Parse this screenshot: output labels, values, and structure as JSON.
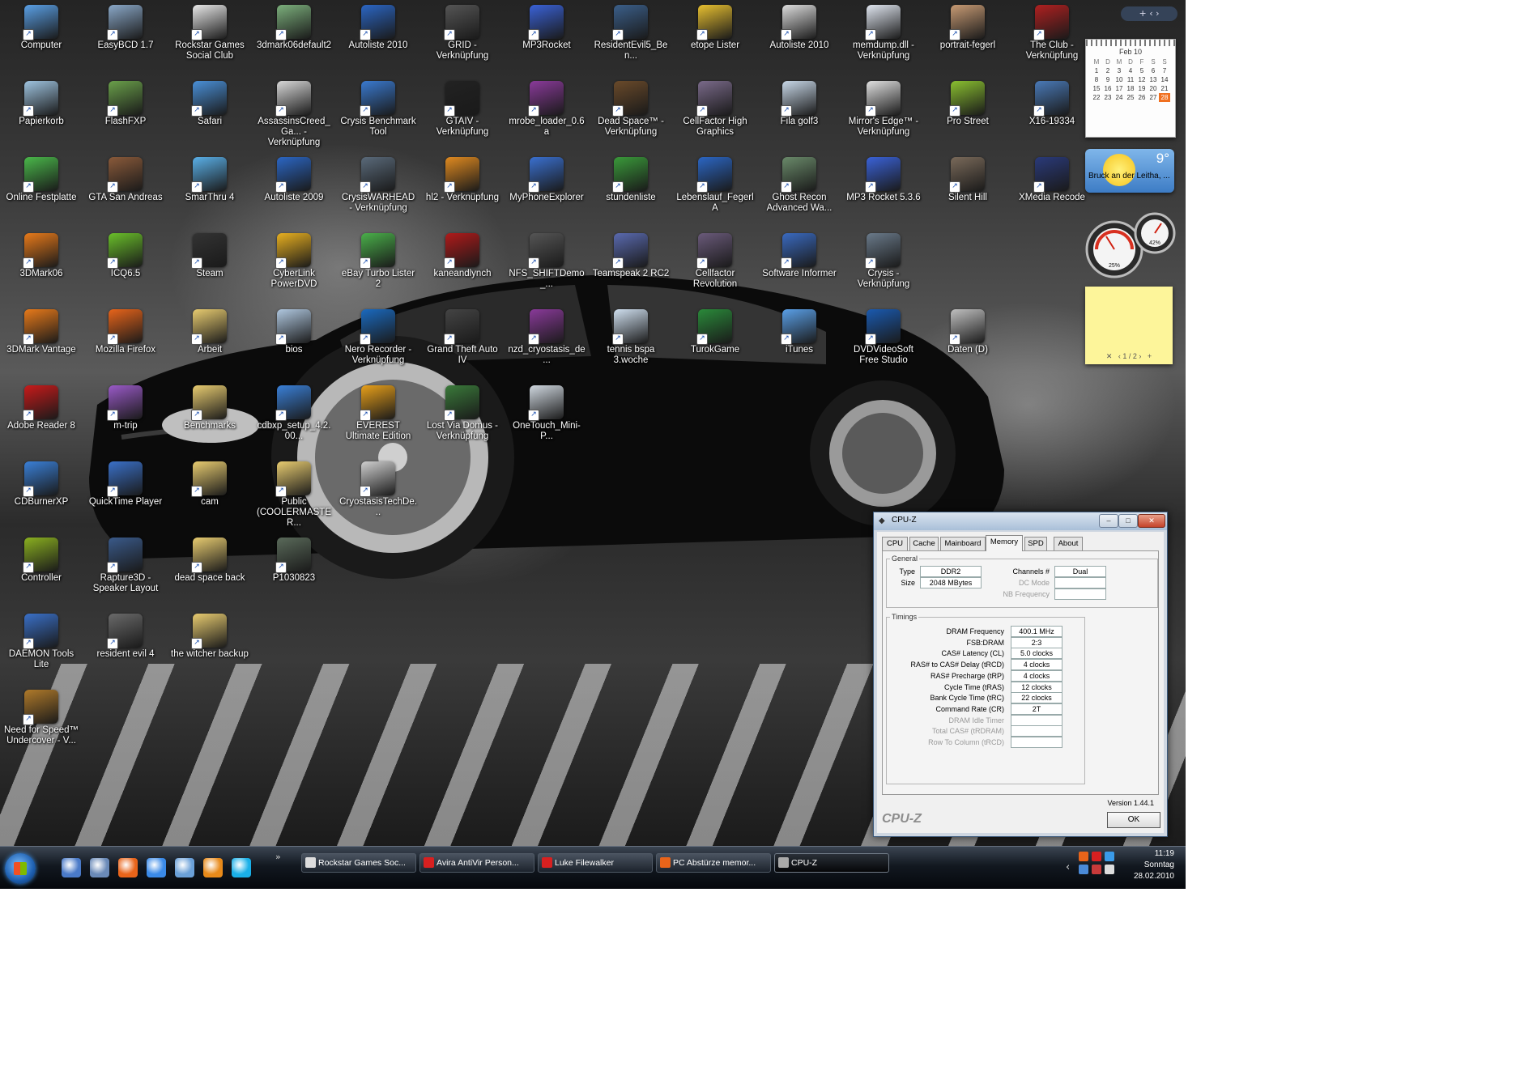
{
  "desktop": {
    "icons": [
      {
        "label": "Computer",
        "color": "#5aa0e6"
      },
      {
        "label": "EasyBCD 1.7",
        "color": "#8aa8c8"
      },
      {
        "label": "Rockstar Games Social Club",
        "color": "#e8e8e8"
      },
      {
        "label": "3dmark06default2",
        "color": "#7cb07c"
      },
      {
        "label": "Autoliste 2010",
        "color": "#2b66c4"
      },
      {
        "label": "GRID - Verknüpfung",
        "color": "#555555"
      },
      {
        "label": "MP3Rocket",
        "color": "#3a62d8"
      },
      {
        "label": "ResidentEvil5_Ben...",
        "color": "#3b5f8a"
      },
      {
        "label": "etope Lister",
        "color": "#e8c030"
      },
      {
        "label": "Autoliste 2010",
        "color": "#dddddd"
      },
      {
        "label": "memdump.dll - Verknüpfung",
        "color": "#e0e6f0"
      },
      {
        "label": "portrait-fegerl",
        "color": "#c89b74"
      },
      {
        "label": "The Club - Verknüpfung",
        "color": "#b02020"
      },
      {
        "label": "Papierkorb",
        "color": "#9fc4e0"
      },
      {
        "label": "FlashFXP",
        "color": "#6aa04a"
      },
      {
        "label": "Safari",
        "color": "#4a90d8"
      },
      {
        "label": "AssassinsCreed_Ga... - Verknüpfung",
        "color": "#d8d8d8"
      },
      {
        "label": "Crysis Benchmark Tool",
        "color": "#3a7ad0"
      },
      {
        "label": "GTAIV - Verknüpfung",
        "color": "#222222"
      },
      {
        "label": "mrobe_loader_0.6a",
        "color": "#8a3a9a"
      },
      {
        "label": "Dead Space™ - Verknüpfung",
        "color": "#6a4a2a"
      },
      {
        "label": "CellFactor High Graphics",
        "color": "#7a6a8a"
      },
      {
        "label": "Fila golf3",
        "color": "#c8d8e8"
      },
      {
        "label": "Mirror's Edge™ - Verknüpfung",
        "color": "#e0e0e0"
      },
      {
        "label": "Pro Street",
        "color": "#8ac030"
      },
      {
        "label": "X16-19334",
        "color": "#4a7ab8"
      },
      {
        "label": "Online Festplatte",
        "color": "#4ab84a"
      },
      {
        "label": "GTA San Andreas",
        "color": "#8a5a3a"
      },
      {
        "label": "SmarThru 4",
        "color": "#5ab0e8"
      },
      {
        "label": "Autoliste 2009",
        "color": "#2b66c4"
      },
      {
        "label": "CrysisWARHEAD - Verknüpfung",
        "color": "#5a6a7a"
      },
      {
        "label": "hl2 - Verknüpfung",
        "color": "#e08a20"
      },
      {
        "label": "MyPhoneExplorer",
        "color": "#3a70d0"
      },
      {
        "label": "stundenliste",
        "color": "#3a9a3a"
      },
      {
        "label": "Lebenslauf_FegerlA",
        "color": "#2b66c4"
      },
      {
        "label": "Ghost Recon Advanced Wa...",
        "color": "#6a8a6a"
      },
      {
        "label": "MP3 Rocket 5.3.6",
        "color": "#3a62d8"
      },
      {
        "label": "Silent Hill",
        "color": "#7a6a5a"
      },
      {
        "label": "XMedia Recode",
        "color": "#2a3a7a"
      },
      {
        "label": "3DMark06",
        "color": "#e87a1a"
      },
      {
        "label": "ICQ6.5",
        "color": "#6ac02a"
      },
      {
        "label": "Steam",
        "color": "#333333"
      },
      {
        "label": "CyberLink PowerDVD",
        "color": "#e8b020"
      },
      {
        "label": "eBay Turbo Lister 2",
        "color": "#4ab04a"
      },
      {
        "label": "kaneandlynch",
        "color": "#b01a1a"
      },
      {
        "label": "NFS_SHIFTDemo_...",
        "color": "#555555"
      },
      {
        "label": "Teamspeak 2 RC2",
        "color": "#5a6ab0"
      },
      {
        "label": "Cellfactor Revolution",
        "color": "#6a5a7a"
      },
      {
        "label": "Software Informer",
        "color": "#3a6ac0"
      },
      {
        "label": "Crysis - Verknüpfung",
        "color": "#6a7a8a"
      },
      {
        "label": "3DMark Vantage",
        "color": "#e87a1a"
      },
      {
        "label": "Mozilla Firefox",
        "color": "#e8641a"
      },
      {
        "label": "Arbeit",
        "color": "#e8cc70"
      },
      {
        "label": "bios",
        "color": "#b0c8e0"
      },
      {
        "label": "Nero Recorder - Verknüpfung",
        "color": "#1a6ac0"
      },
      {
        "label": "Grand Theft Auto IV",
        "color": "#444444"
      },
      {
        "label": "nzd_cryostasis_de...",
        "color": "#8a3a9a"
      },
      {
        "label": "tennis bspa 3.woche",
        "color": "#d0e0f0"
      },
      {
        "label": "TurokGame",
        "color": "#2a8a3a"
      },
      {
        "label": "iTunes",
        "color": "#5aa0e8"
      },
      {
        "label": "DVDVideoSoft Free Studio",
        "color": "#1a5ab0"
      },
      {
        "label": "Daten (D)",
        "color": "#c0c0c0"
      },
      {
        "label": "Adobe Reader 8",
        "color": "#c81a1a"
      },
      {
        "label": "m-trip",
        "color": "#9a5ac8"
      },
      {
        "label": "Benchmarks",
        "color": "#e8cc70"
      },
      {
        "label": "cdbxp_setup_4.2.00...",
        "color": "#3a80d8"
      },
      {
        "label": "EVEREST Ultimate Edition",
        "color": "#e8a01a"
      },
      {
        "label": "Lost Via Domus - Verknüpfung",
        "color": "#3a7a3a"
      },
      {
        "label": "OneTouch_Mini-P...",
        "color": "#d0d8e0"
      },
      {
        "label": "CDBurnerXP",
        "color": "#3a80d8"
      },
      {
        "label": "QuickTime Player",
        "color": "#3a70c8"
      },
      {
        "label": "cam",
        "color": "#e8cc70"
      },
      {
        "label": "Public (COOLERMASTER...",
        "color": "#e8cc70"
      },
      {
        "label": "CryostasisTechDe...",
        "color": "#cfcfcf"
      },
      {
        "label": "Controller",
        "color": "#8ab020"
      },
      {
        "label": "Rapture3D - Speaker Layout",
        "color": "#3a5a8a"
      },
      {
        "label": "dead space back",
        "color": "#e8cc70"
      },
      {
        "label": "P1030823",
        "color": "#5a6a5a"
      },
      {
        "label": "DAEMON Tools Lite",
        "color": "#3a70c8"
      },
      {
        "label": "resident evil 4",
        "color": "#6a6a6a"
      },
      {
        "label": "the witcher backup",
        "color": "#e8cc70"
      },
      {
        "label": "Need for Speed™ Undercover - V...",
        "color": "#b07a2a"
      }
    ]
  },
  "gadgets": {
    "calendar": {
      "month": "Feb 10",
      "weekdays": [
        "M",
        "D",
        "M",
        "D",
        "F",
        "S",
        "S"
      ],
      "weeks": [
        [
          "1",
          "2",
          "3",
          "4",
          "5",
          "6",
          "7"
        ],
        [
          "8",
          "9",
          "10",
          "11",
          "12",
          "13",
          "14"
        ],
        [
          "15",
          "16",
          "17",
          "18",
          "19",
          "20",
          "21"
        ],
        [
          "22",
          "23",
          "24",
          "25",
          "26",
          "27",
          "28"
        ]
      ],
      "today": "28"
    },
    "weather": {
      "temp": "9°",
      "city": "Bruck an der Leitha, ..."
    },
    "meters": {
      "cpu": "25%",
      "ram": "42%"
    },
    "notes": {
      "pager": "1 / 2"
    }
  },
  "cpuz": {
    "title": "CPU-Z",
    "tabs": [
      "CPU",
      "Cache",
      "Mainboard",
      "Memory",
      "SPD",
      "About"
    ],
    "active_tab": "Memory",
    "general": {
      "legend": "General",
      "type_label": "Type",
      "type_value": "DDR2",
      "size_label": "Size",
      "size_value": "2048 MBytes",
      "channels_label": "Channels #",
      "channels_value": "Dual",
      "dcmode_label": "DC Mode",
      "dcmode_value": "",
      "nbfreq_label": "NB Frequency",
      "nbfreq_value": ""
    },
    "timings": {
      "legend": "Timings",
      "rows": [
        {
          "label": "DRAM Frequency",
          "value": "400.1 MHz",
          "enabled": true
        },
        {
          "label": "FSB:DRAM",
          "value": "2:3",
          "enabled": true
        },
        {
          "label": "CAS# Latency (CL)",
          "value": "5.0 clocks",
          "enabled": true
        },
        {
          "label": "RAS# to CAS# Delay (tRCD)",
          "value": "4 clocks",
          "enabled": true
        },
        {
          "label": "RAS# Precharge (tRP)",
          "value": "4 clocks",
          "enabled": true
        },
        {
          "label": "Cycle Time (tRAS)",
          "value": "12 clocks",
          "enabled": true
        },
        {
          "label": "Bank Cycle Time (tRC)",
          "value": "22 clocks",
          "enabled": true
        },
        {
          "label": "Command Rate (CR)",
          "value": "2T",
          "enabled": true
        },
        {
          "label": "DRAM Idle Timer",
          "value": "",
          "enabled": false
        },
        {
          "label": "Total CAS# (tRDRAM)",
          "value": "",
          "enabled": false
        },
        {
          "label": "Row To Column (tRCD)",
          "value": "",
          "enabled": false
        }
      ]
    },
    "version": "Version 1.44.1",
    "brand": "CPU-Z",
    "ok_label": "OK"
  },
  "taskbar": {
    "quicklaunch": [
      {
        "name": "show-desktop",
        "color": "#4a7ac8"
      },
      {
        "name": "switch-windows",
        "color": "#6a8ab8"
      },
      {
        "name": "firefox",
        "color": "#e8641a"
      },
      {
        "name": "internet-explorer",
        "color": "#3a8ae8"
      },
      {
        "name": "explorer",
        "color": "#6aa0d8"
      },
      {
        "name": "media-player",
        "color": "#e88a1a"
      },
      {
        "name": "skype",
        "color": "#1ab0e8"
      }
    ],
    "overflow": "»",
    "buttons": [
      {
        "label": "Rockstar Games Soc...",
        "color": "#dddddd"
      },
      {
        "label": "Avira AntiVir Person...",
        "color": "#d82020"
      },
      {
        "label": "Luke Filewalker",
        "color": "#d82020"
      },
      {
        "label": "PC Abstürze memor...",
        "color": "#e8641a"
      },
      {
        "label": "CPU-Z",
        "color": "#aaaaaa"
      }
    ],
    "active_button": "CPU-Z",
    "clock": {
      "time": "11:19",
      "day": "Sonntag",
      "date": "28.02.2010"
    },
    "tray_arrow": "‹"
  }
}
